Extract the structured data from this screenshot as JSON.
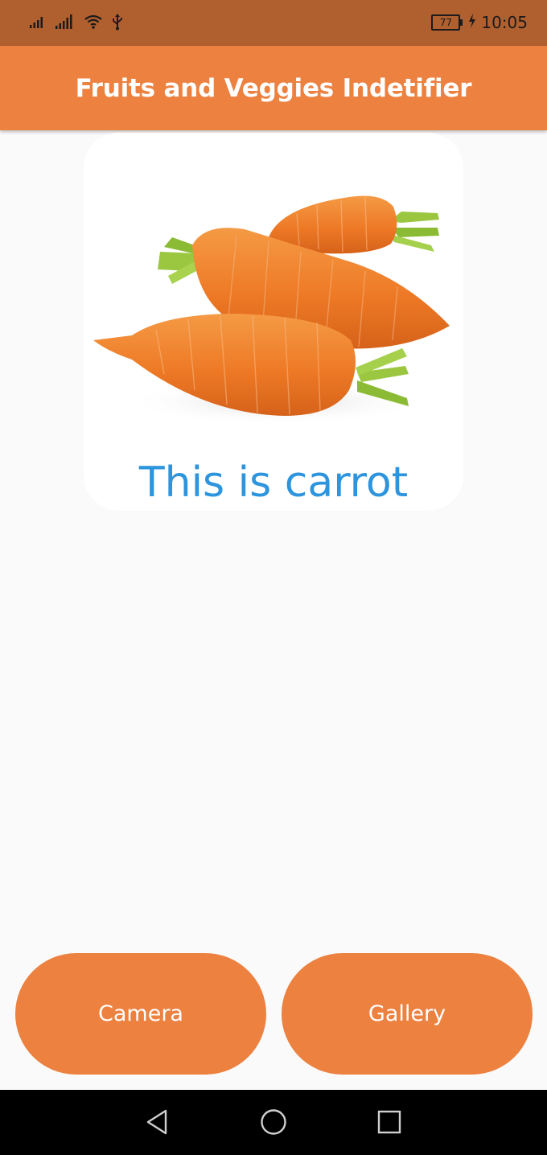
{
  "status_bar": {
    "battery": "77",
    "time": "10:05",
    "icons": [
      "signal-icon",
      "signal-icon",
      "wifi-icon",
      "usb-icon",
      "battery-icon",
      "charging-icon"
    ]
  },
  "app_bar": {
    "title": "Fruits and Veggies Indetifier"
  },
  "result": {
    "image": "carrots",
    "label": "This is carrot"
  },
  "buttons": {
    "camera": "Camera",
    "gallery": "Gallery"
  },
  "nav_bar": {
    "icons": [
      "back-icon",
      "home-icon",
      "recents-icon"
    ]
  },
  "colors": {
    "status_bar": "#b05f2f",
    "accent": "#ec8140",
    "result_text": "#2d94de",
    "background": "#fafafa"
  }
}
